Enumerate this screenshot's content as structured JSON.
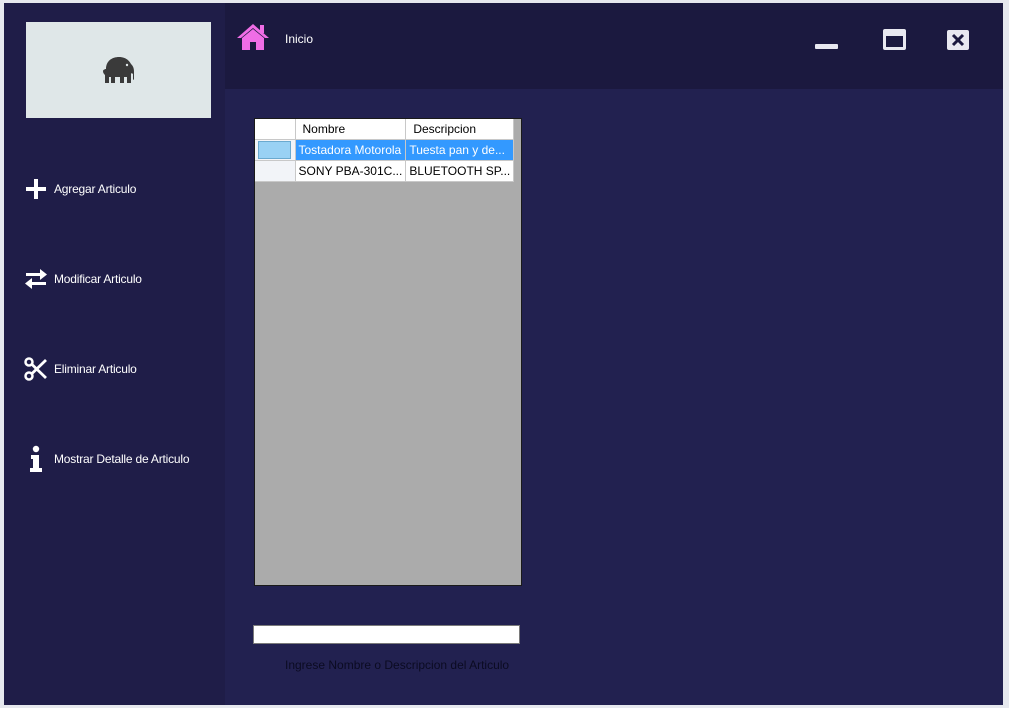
{
  "window": {
    "accent_color": "#1f1d48",
    "topbar_color": "#1b193f",
    "content_color": "#222150"
  },
  "sidebar": {
    "logo_icon": "elephant-icon",
    "items": [
      {
        "label": "Agregar Articulo",
        "icon": "plus-icon"
      },
      {
        "label": "Modificar Articulo",
        "icon": "swap-arrows-icon"
      },
      {
        "label": "Eliminar Articulo",
        "icon": "scissors-icon"
      },
      {
        "label": "Mostrar Detalle de Articulo",
        "icon": "info-icon"
      }
    ]
  },
  "header": {
    "home_icon": "home-icon",
    "home_color": "#f06de6",
    "title": "Inicio",
    "controls": [
      "minimize-icon",
      "maximize-icon",
      "close-icon"
    ]
  },
  "grid": {
    "columns": [
      "Nombre",
      "Descripcion"
    ],
    "rows": [
      {
        "nombre": "Tostadora Motorola",
        "descripcion": "Tuesta pan y de...",
        "selected": true
      },
      {
        "nombre": "SONY PBA-301C...",
        "descripcion": "BLUETOOTH SP...",
        "selected": false
      }
    ],
    "selection_color": "#3399ff"
  },
  "search": {
    "value": "",
    "hint": "Ingrese Nombre o Descripcion del Articulo"
  }
}
